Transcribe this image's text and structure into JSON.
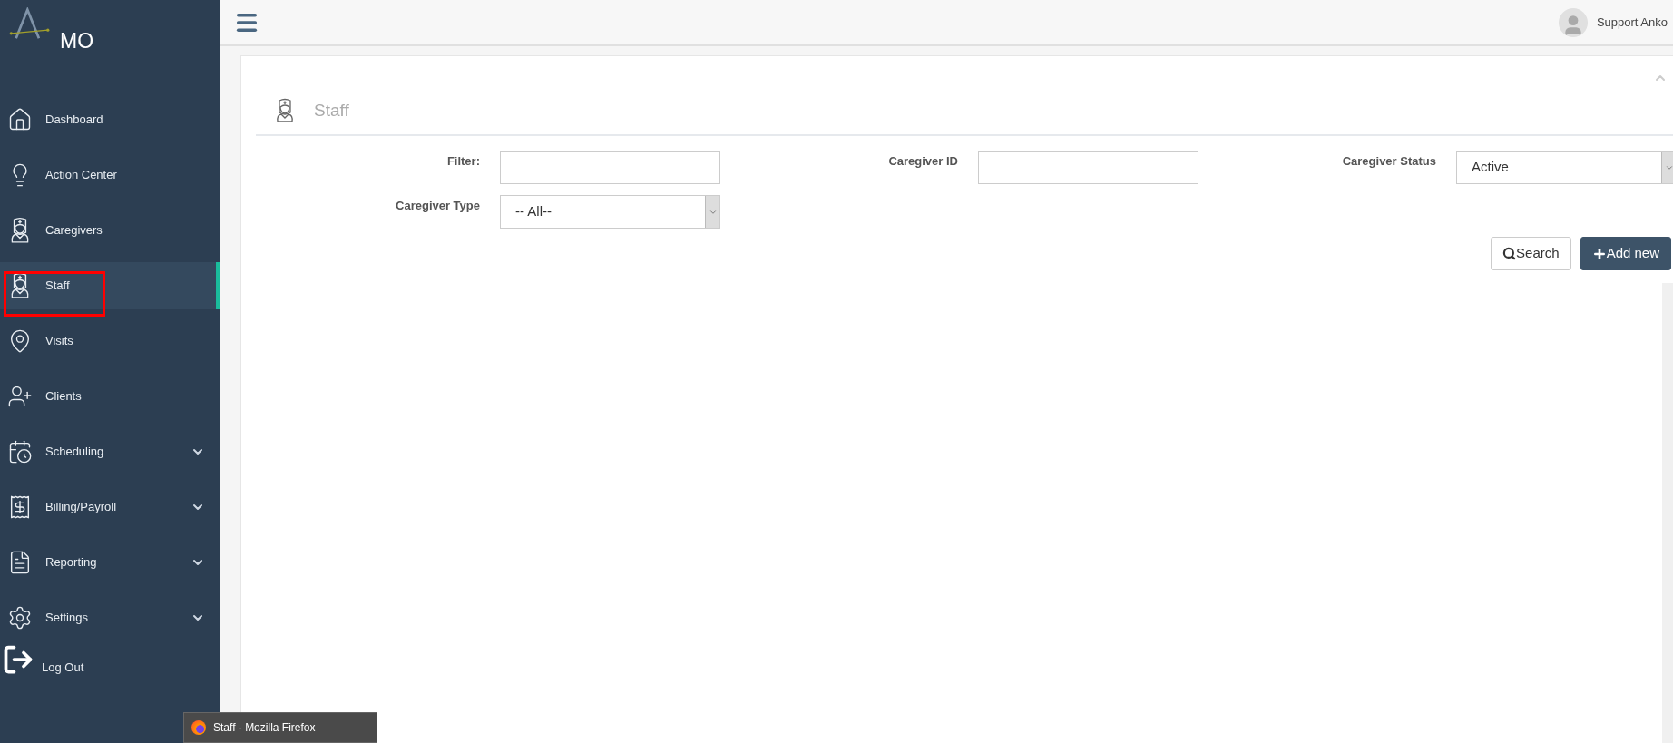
{
  "brand": {
    "name": "MO"
  },
  "sidebar": {
    "items": [
      {
        "label": "Dashboard",
        "selected": false,
        "expandable": false,
        "highlighted": false
      },
      {
        "label": "Action Center",
        "selected": false,
        "expandable": false,
        "highlighted": false
      },
      {
        "label": "Caregivers",
        "selected": false,
        "expandable": false,
        "highlighted": false
      },
      {
        "label": "Staff",
        "selected": true,
        "expandable": false,
        "highlighted": true
      },
      {
        "label": "Visits",
        "selected": false,
        "expandable": false,
        "highlighted": false
      },
      {
        "label": "Clients",
        "selected": false,
        "expandable": false,
        "highlighted": false
      },
      {
        "label": "Scheduling",
        "selected": false,
        "expandable": true,
        "highlighted": false
      },
      {
        "label": "Billing/Payroll",
        "selected": false,
        "expandable": true,
        "highlighted": false
      },
      {
        "label": "Reporting",
        "selected": false,
        "expandable": true,
        "highlighted": false
      },
      {
        "label": "Settings",
        "selected": false,
        "expandable": true,
        "highlighted": false
      }
    ],
    "logout": "Log Out"
  },
  "header": {
    "user": "Support Anko"
  },
  "page": {
    "title": "Staff",
    "filters": [
      {
        "label": "Filter:",
        "kind": "input"
      },
      {
        "label": "Caregiver ID",
        "kind": "input"
      },
      {
        "label": "Caregiver Status",
        "kind": "select",
        "value": "Active"
      },
      {
        "label": "Caregiver Type",
        "kind": "select",
        "value": "-- All--"
      }
    ],
    "buttons": [
      {
        "label": "Search",
        "kind": "secondary"
      },
      {
        "label": "Add new",
        "kind": "primary"
      }
    ]
  },
  "taskbar_tooltip": {
    "title": "Staff - Mozilla Firefox"
  }
}
